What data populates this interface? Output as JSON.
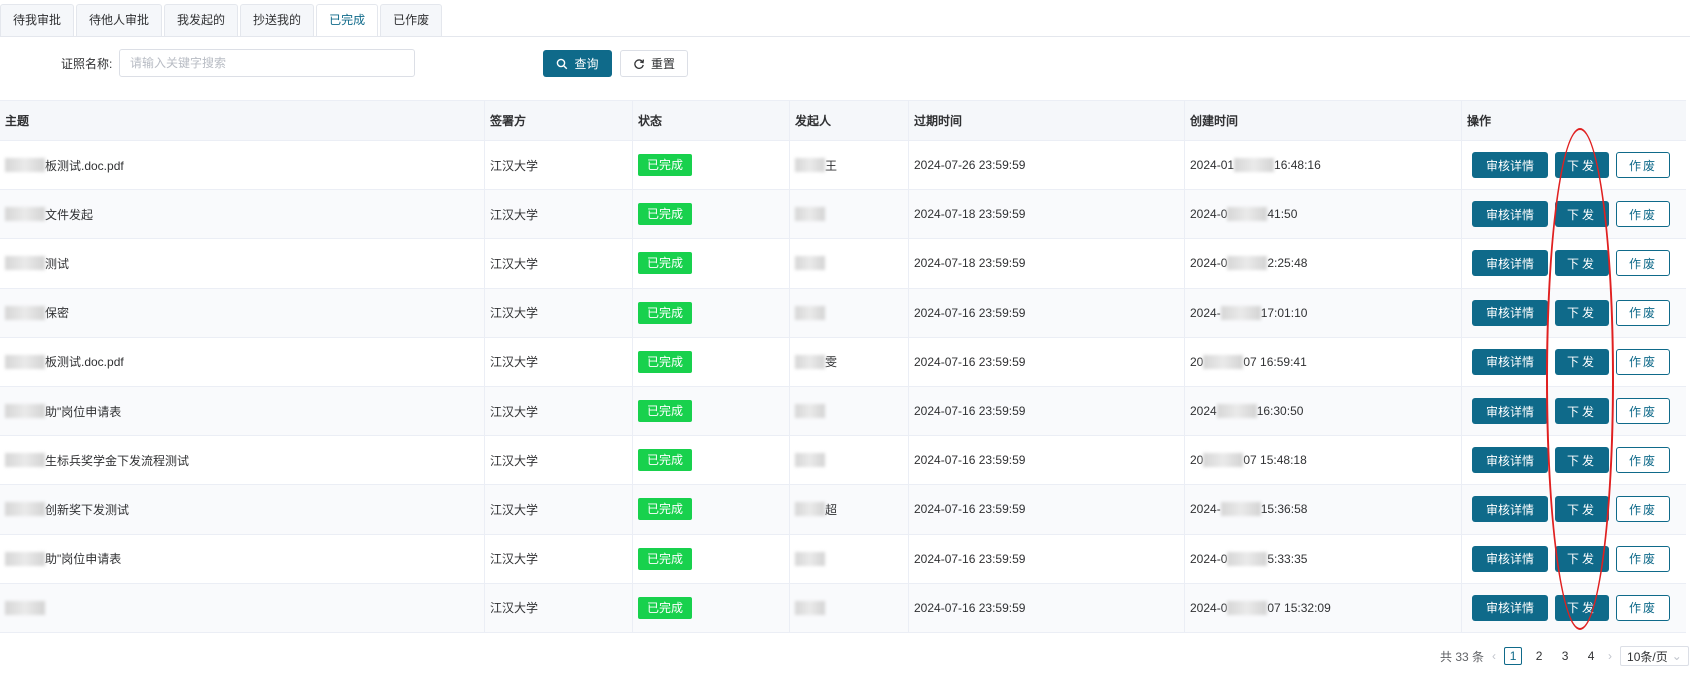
{
  "tabs": [
    "待我审批",
    "待他人审批",
    "我发起的",
    "抄送我的",
    "已完成",
    "已作废"
  ],
  "active_tab": "已完成",
  "search": {
    "label": "证照名称:",
    "placeholder": "请输入关键字搜索",
    "value": "",
    "query_label": "查询",
    "reset_label": "重置"
  },
  "table": {
    "columns": [
      "主题",
      "签署方",
      "状态",
      "发起人",
      "过期时间",
      "创建时间",
      "操作"
    ],
    "rows": [
      {
        "subject": "板测试.doc.pdf",
        "signer": "江汉大学",
        "status": "已完成",
        "initiator": "王",
        "expire": "2024-07-26 23:59:59",
        "created": "2024-01",
        "created_tail": "16:48:16"
      },
      {
        "subject": "文件发起",
        "signer": "江汉大学",
        "status": "已完成",
        "initiator": "",
        "expire": "2024-07-18 23:59:59",
        "created": "2024-0",
        "created_tail": "41:50"
      },
      {
        "subject": "测试",
        "signer": "江汉大学",
        "status": "已完成",
        "initiator": "",
        "expire": "2024-07-18 23:59:59",
        "created": "2024-0",
        "created_tail": "2:25:48"
      },
      {
        "subject": "保密",
        "signer": "江汉大学",
        "status": "已完成",
        "initiator": "",
        "expire": "2024-07-16 23:59:59",
        "created": "2024-",
        "created_tail": "17:01:10"
      },
      {
        "subject": "板测试.doc.pdf",
        "signer": "江汉大学",
        "status": "已完成",
        "initiator": "雯",
        "expire": "2024-07-16 23:59:59",
        "created": "20",
        "created_tail": "07 16:59:41"
      },
      {
        "subject": "助\"岗位申请表",
        "signer": "江汉大学",
        "status": "已完成",
        "initiator": "",
        "expire": "2024-07-16 23:59:59",
        "created": "2024",
        "created_tail": "16:30:50"
      },
      {
        "subject": "生标兵奖学金下发流程测试",
        "signer": "江汉大学",
        "status": "已完成",
        "initiator": "",
        "expire": "2024-07-16 23:59:59",
        "created": "20",
        "created_tail": "07 15:48:18"
      },
      {
        "subject": "创新奖下发测试",
        "signer": "江汉大学",
        "status": "已完成",
        "initiator": "超",
        "expire": "2024-07-16 23:59:59",
        "created": "2024-",
        "created_tail": "15:36:58"
      },
      {
        "subject": "助\"岗位申请表",
        "signer": "江汉大学",
        "status": "已完成",
        "initiator": "",
        "expire": "2024-07-16 23:59:59",
        "created": "2024-0",
        "created_tail": "5:33:35"
      },
      {
        "subject": "",
        "signer": "江汉大学",
        "status": "已完成",
        "initiator": "",
        "expire": "2024-07-16 23:59:59",
        "created": "2024-0",
        "created_tail": "07 15:32:09"
      }
    ],
    "actions": {
      "detail": "审核详情",
      "issue": "下发",
      "void": "作废"
    }
  },
  "pagination": {
    "total_label": "共 33 条",
    "pages": [
      "1",
      "2",
      "3",
      "4"
    ],
    "current": "1",
    "page_size": "10条/页"
  },
  "colors": {
    "primary": "#0f6a8a",
    "status_done": "#18d14d",
    "annotation": "#e02020"
  },
  "icons": {
    "query": "search-icon",
    "reset": "refresh-icon",
    "prev": "chevron-left-icon",
    "next": "chevron-right-icon",
    "size": "chevron-down-icon"
  }
}
